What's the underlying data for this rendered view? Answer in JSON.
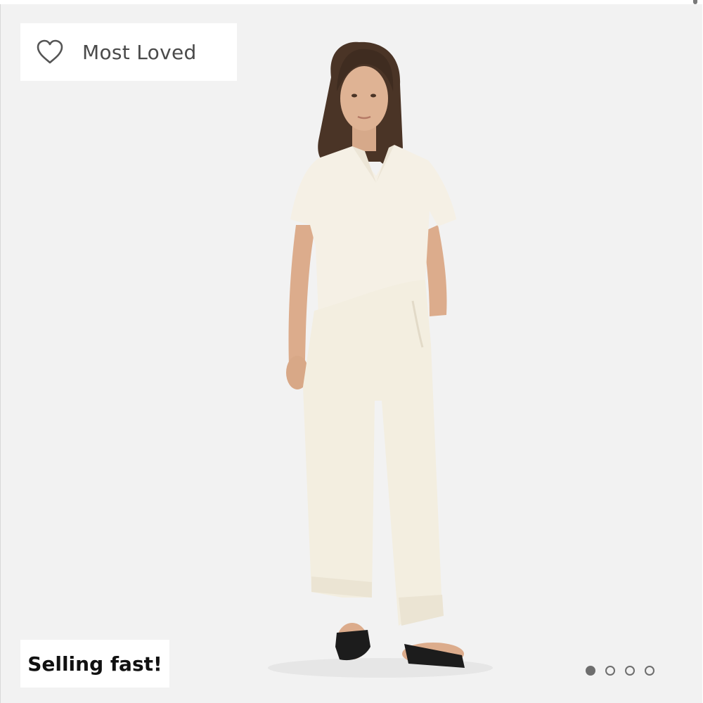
{
  "product_card": {
    "badge_top": {
      "icon": "heart-outline-icon",
      "label": "Most Loved"
    },
    "badge_bottom": {
      "label": "Selling fast!"
    },
    "image": {
      "subject": "model-photo"
    },
    "carousel": {
      "total": 4,
      "active_index": 0
    },
    "colors": {
      "background": "#f2f2f2",
      "garment": "#f4efe2",
      "dot": "#6e6e6e"
    }
  }
}
